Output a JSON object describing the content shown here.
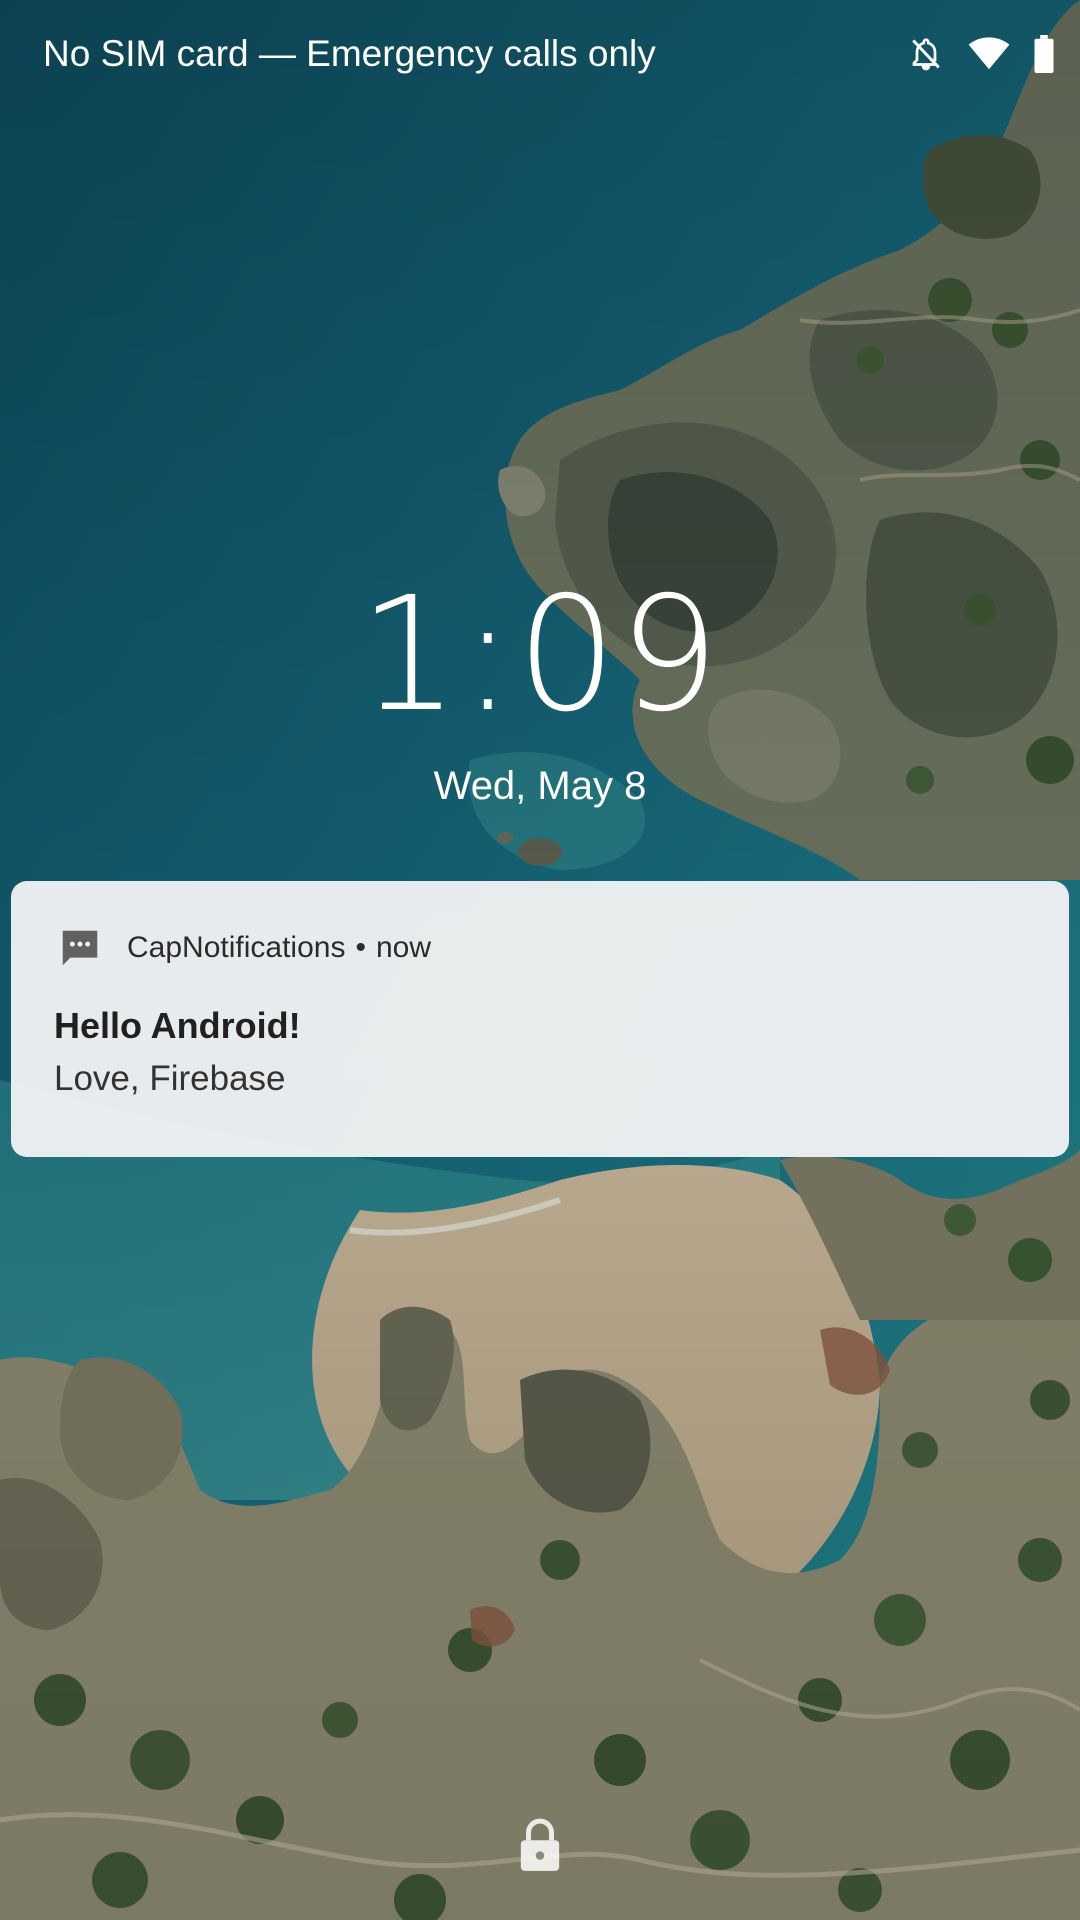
{
  "status_bar": {
    "carrier_text": "No SIM card — Emergency calls only",
    "icons": [
      "notifications-off-icon",
      "wifi-icon",
      "battery-icon"
    ]
  },
  "lockscreen": {
    "time": "1:09",
    "date": "Wed, May 8"
  },
  "notification": {
    "app_icon": "message-icon",
    "app_name": "CapNotifications",
    "separator": "•",
    "time": "now",
    "title": "Hello Android!",
    "text": "Love, Firebase"
  },
  "bottom": {
    "icon": "lock-icon"
  },
  "colors": {
    "text_light": "#ffffff",
    "card_bg": "#f0f1f2",
    "card_text": "#202020",
    "icon_gray": "#666666"
  }
}
